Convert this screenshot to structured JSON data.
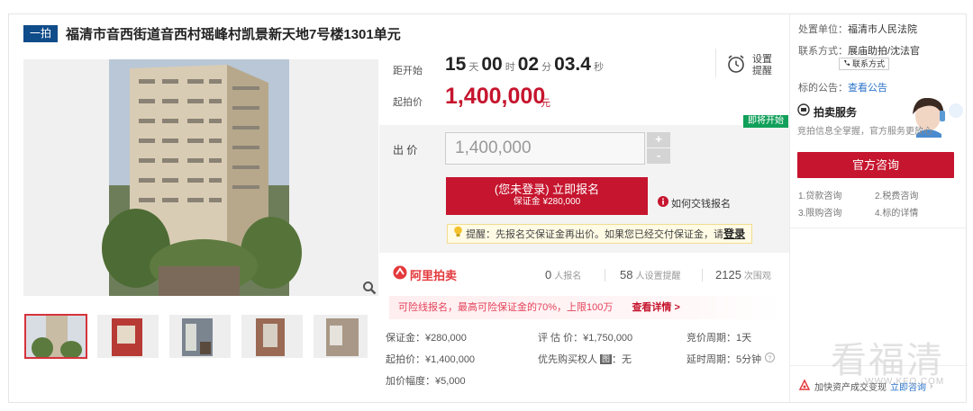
{
  "header": {
    "badge": "一拍",
    "title": "福清市音西街道音西村瑶峰村凯景新天地7号楼1301单元"
  },
  "countdown": {
    "label": "距开始",
    "days": "15",
    "days_unit": "天",
    "hours": "00",
    "hours_unit": "时",
    "minutes": "02",
    "minutes_unit": "分",
    "seconds": "03.4",
    "seconds_unit": "秒",
    "reminder_line1": "设置",
    "reminder_line2": "提醒"
  },
  "start_price": {
    "label": "起拍价",
    "value": "1,400,000",
    "unit": "元"
  },
  "bid": {
    "label": "出 价",
    "value": "1,400,000",
    "plus": "+",
    "minus": "-",
    "soon_badge": "即将开始"
  },
  "signup": {
    "main": "(您未登录) 立即报名",
    "sub": "保证金 ¥280,000",
    "how_link": "如何交钱报名"
  },
  "tip": {
    "text": "提醒：先报名交保证金再出价。如果您已经交付保证金，请",
    "link": "登录"
  },
  "stats": {
    "brand": "阿里拍卖",
    "signups_num": "0",
    "signups_label": "人报名",
    "reminders_num": "58",
    "reminders_label": "人设置提醒",
    "views_num": "2125",
    "views_label": "次围观"
  },
  "promo": {
    "text": "可险线报名，最高可险保证金的70%，上限100万",
    "link": "查看详情 >"
  },
  "details": {
    "deposit": "保证金：¥280,000",
    "appraisal": "评 估 价：¥1,750,000",
    "cycle": "竞价周期：1天",
    "start": "起拍价：¥1,400,000",
    "priority_label": "优先购买权人",
    "priority_badge": "图",
    "priority_value": "：无",
    "delay": "延时周期：5分钟",
    "increment": "加价幅度：¥5,000"
  },
  "sidebar": {
    "unit_label": "处置单位：",
    "unit_value": "福清市人民法院",
    "contact_label": "联系方式：",
    "contact_value": "展庙助拍/沈法官",
    "contact_button": "联系方式",
    "notice_label": "标的公告：",
    "notice_link": "查看公告",
    "service_title": "拍卖服务",
    "service_desc": "竞拍信息全掌握，官方服务更放心",
    "consult_button": "官方咨询",
    "links": [
      "1.贷款咨询",
      "2.税费咨询",
      "3.限购咨询",
      "4.标的详情"
    ],
    "bottom_text": "加快资产成交变现",
    "bottom_link": "立即咨询"
  },
  "watermark": {
    "main": "看福清",
    "sub": "WWW.KFQ.COM"
  },
  "colors": {
    "accent": "#c6152e",
    "brand_blue": "#0f4c8a",
    "green": "#11a05a"
  }
}
